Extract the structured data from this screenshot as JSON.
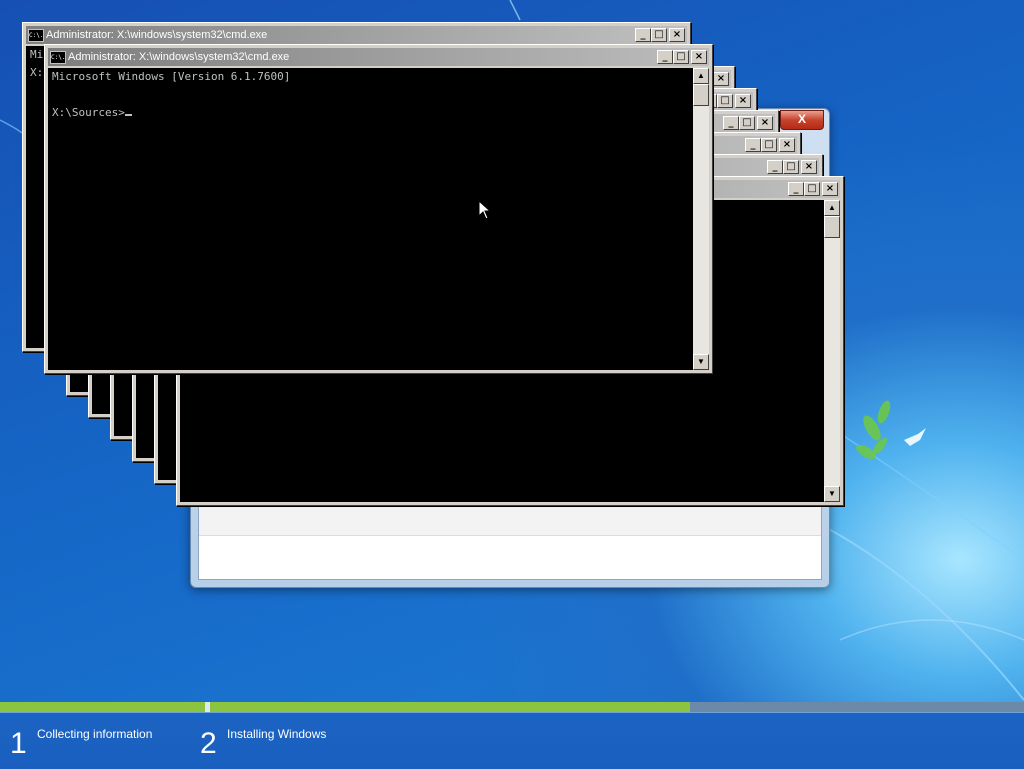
{
  "cmd_window": {
    "title": "Administrator: X:\\windows\\system32\\cmd.exe",
    "icon_text": "C:\\.",
    "console_line_1": "Microsoft Windows [Version 6.1.7600]",
    "console_line_2": "X:\\Sources>",
    "back_window_fragment_1": "Mi",
    "back_window_fragment_2": "X:"
  },
  "window_buttons": {
    "minimize": "_",
    "maximize": "□",
    "close": "×"
  },
  "setup_window": {
    "close": "X"
  },
  "setup_progress": {
    "step1_number": "1",
    "step1_label": "Collecting information",
    "step2_number": "2",
    "step2_label": "Installing Windows",
    "step2_progress": 0.59
  },
  "colors": {
    "progress_fill": "#8bc53f",
    "desktop_blue": "#1a5fbf"
  },
  "icons": [
    "cmd-icon",
    "minimize-icon",
    "maximize-icon",
    "close-icon",
    "scroll-up-icon",
    "scroll-down-icon",
    "mouse-pointer-icon"
  ]
}
